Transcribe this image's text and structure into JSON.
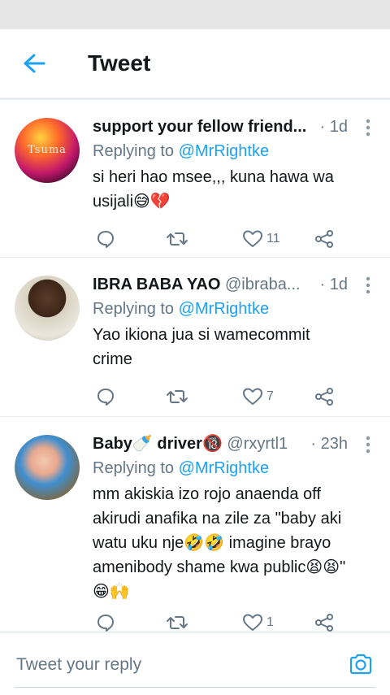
{
  "header": {
    "title": "Tweet"
  },
  "tweets": [
    {
      "name": "support your fellow friend...",
      "handle": "",
      "time": "· 1d",
      "replying_prefix": "Replying to",
      "replying_to": "@MrRightke",
      "text_lines": [
        "si heri hao msee,,, kuna hawa wa",
        "usijali😅💔"
      ],
      "avatar_label": "Tsuma",
      "counts": {
        "reply": "",
        "retweet": "",
        "like": "11"
      }
    },
    {
      "name": "IBRA BABA YAO",
      "handle": "@ibraba...",
      "time": "· 1d",
      "replying_prefix": "Replying to",
      "replying_to": "@MrRightke",
      "text_lines": [
        "Yao ikiona jua si wamecommit",
        "crime"
      ],
      "counts": {
        "reply": "",
        "retweet": "",
        "like": "7"
      }
    },
    {
      "name": "Baby🍼 driver🔞",
      "handle": "@rxyrtl1",
      "time": "· 23h",
      "replying_prefix": "Replying to",
      "replying_to": "@MrRightke",
      "text_lines": [
        "mm akiskia izo rojo anaenda off",
        "akirudi anafika na zile za \"baby aki",
        "watu uku nje🤣🤣 imagine brayo",
        "amenibody shame kwa public😫😫\"",
        "😁🙌"
      ],
      "counts": {
        "reply": "",
        "retweet": "",
        "like": "1"
      }
    }
  ],
  "composer": {
    "placeholder": "Tweet your reply"
  },
  "colors": {
    "accent": "#1da1f2",
    "muted": "#657786",
    "text": "#14171a"
  }
}
